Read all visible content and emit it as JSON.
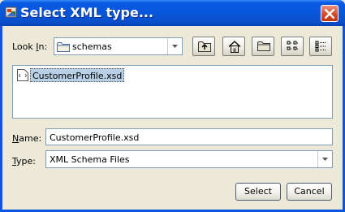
{
  "window": {
    "title": "Select XML type..."
  },
  "toolbar": {
    "look_in_label_prefix": "Look ",
    "look_in_label_mnemonic": "I",
    "look_in_label_suffix": "n:",
    "look_in_value": "schemas",
    "buttons": [
      "up-folder",
      "home",
      "new-folder",
      "list-view",
      "details-view"
    ]
  },
  "files": [
    {
      "name": "CustomerProfile.xsd",
      "selected": true
    }
  ],
  "form": {
    "name_label_mnemonic": "N",
    "name_label_rest": "ame:",
    "name_value": "CustomerProfile.xsd",
    "type_label_mnemonic": "T",
    "type_label_rest": "ype:",
    "type_value": "XML Schema Files"
  },
  "actions": {
    "select_label": "Select",
    "cancel_label": "Cancel"
  },
  "colors": {
    "titlebar": "#0a56e0",
    "selection": "#b8cfe5",
    "close": "#d2461f"
  }
}
